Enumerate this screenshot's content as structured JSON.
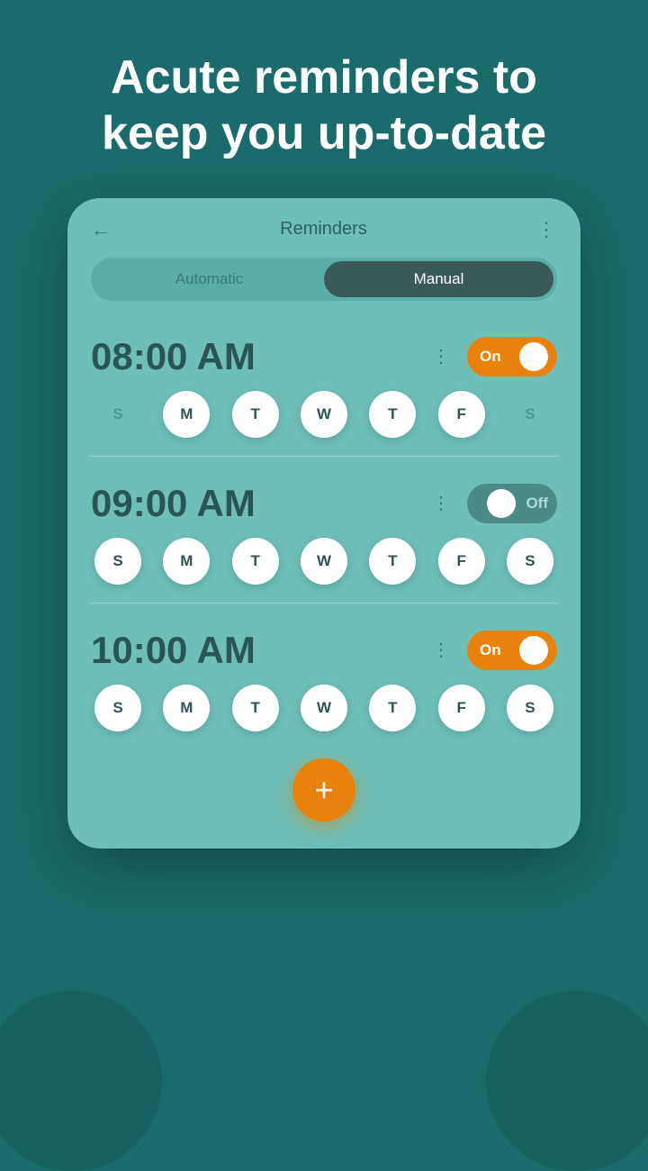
{
  "headline": "Acute reminders to keep you up-to-date",
  "header": {
    "title": "Reminders",
    "back_label": "←",
    "more_label": "⋮"
  },
  "tabs": [
    {
      "label": "Automatic",
      "active": false
    },
    {
      "label": "Manual",
      "active": true
    }
  ],
  "reminders": [
    {
      "time": "08:00 AM",
      "toggle_state": "on",
      "toggle_label": "On",
      "days": [
        {
          "label": "S",
          "active": false
        },
        {
          "label": "M",
          "active": true
        },
        {
          "label": "T",
          "active": true
        },
        {
          "label": "W",
          "active": true
        },
        {
          "label": "T",
          "active": true
        },
        {
          "label": "F",
          "active": true
        },
        {
          "label": "S",
          "active": false
        }
      ]
    },
    {
      "time": "09:00 AM",
      "toggle_state": "off",
      "toggle_label": "Off",
      "days": [
        {
          "label": "S",
          "active": true
        },
        {
          "label": "M",
          "active": true
        },
        {
          "label": "T",
          "active": true
        },
        {
          "label": "W",
          "active": true
        },
        {
          "label": "T",
          "active": true
        },
        {
          "label": "F",
          "active": true
        },
        {
          "label": "S",
          "active": true
        }
      ]
    },
    {
      "time": "10:00 AM",
      "toggle_state": "on",
      "toggle_label": "On",
      "days": [
        {
          "label": "S",
          "active": true
        },
        {
          "label": "M",
          "active": true
        },
        {
          "label": "T",
          "active": true
        },
        {
          "label": "W",
          "active": true
        },
        {
          "label": "T",
          "active": true
        },
        {
          "label": "F",
          "active": true
        },
        {
          "label": "S",
          "active": true
        }
      ]
    }
  ],
  "add_button_label": "+"
}
